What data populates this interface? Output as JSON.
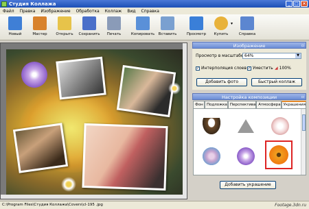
{
  "window": {
    "title": "Студия Коллажа",
    "controls": [
      "_",
      "□",
      "×"
    ]
  },
  "menu": [
    "Файл",
    "Правка",
    "Изображение",
    "Обработка",
    "Коллаж",
    "Вид",
    "Справка"
  ],
  "toolbar": {
    "buttons": [
      {
        "label": "Новый",
        "icon": "new-document-icon",
        "color": "#3f7fd6"
      },
      {
        "label": "Мастер",
        "icon": "wizard-icon",
        "color": "#d8822c"
      },
      {
        "label": "Открыть",
        "icon": "folder-open-icon",
        "color": "#e7c34a"
      },
      {
        "label": "Сохранить",
        "icon": "save-disk-icon",
        "color": "#4a6fc9"
      },
      {
        "label": "Печать",
        "icon": "printer-icon",
        "color": "#8a9bb8"
      },
      {
        "label": "Копировать",
        "icon": "copy-icon",
        "color": "#5a90d8"
      },
      {
        "label": "Вставить",
        "icon": "paste-icon",
        "color": "#7aa0d0"
      },
      {
        "label": "Просмотр",
        "icon": "preview-monitor-icon",
        "color": "#3a7fd8"
      },
      {
        "label": "Купить",
        "icon": "buy-cart-icon",
        "color": "#e8b23a"
      },
      {
        "label": "Справка",
        "icon": "help-book-icon",
        "color": "#5c86d0"
      }
    ]
  },
  "image_panel": {
    "title": "Изображение",
    "zoom_label": "Просмотр в масштабе",
    "zoom_value": "64%",
    "interpolation_label": "Интерполяция слоев",
    "interpolation_checked": "✓",
    "fit_label": "Уместить",
    "fit_checked": "✓",
    "hundred_label": "100%",
    "add_photo_button": "Добавить фото",
    "quick_collage_button": "Быстрый коллаж"
  },
  "composition_panel": {
    "title": "Настройка композиции",
    "tabs": [
      "Фон",
      "Подложка",
      "Перспектива",
      "Атмосфера",
      "Украшения"
    ],
    "active_tab": "Украшения",
    "decorations": [
      {
        "icon": "eagle-icon"
      },
      {
        "icon": "triangle-button-icon"
      },
      {
        "icon": "white-rose-icon"
      },
      {
        "icon": "floral-pattern-icon"
      },
      {
        "icon": "purple-flower-icon"
      },
      {
        "icon": "heart-beads-icon"
      },
      {
        "icon": "ornament-icon"
      },
      {
        "icon": "crystal-ball-icon"
      },
      {
        "icon": "orange-gerbera-icon"
      }
    ],
    "add_decoration_button": "Добавить украшение"
  },
  "status": {
    "path": "C:\\Program Files\\Студия Коллажа\\Covers\\cl-195 .jpg"
  },
  "watermark": "Footage.3dn.ru"
}
